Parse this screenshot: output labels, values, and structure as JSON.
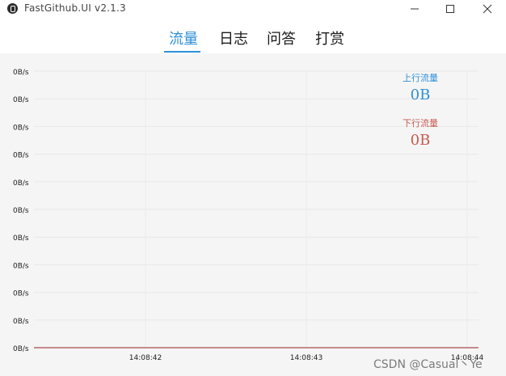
{
  "window": {
    "title": "FastGithub.UI v2.1.3"
  },
  "tabs": [
    {
      "label": "流量",
      "active": true
    },
    {
      "label": "日志",
      "active": false
    },
    {
      "label": "问答",
      "active": false
    },
    {
      "label": "打赏",
      "active": false
    }
  ],
  "legend": {
    "up_label": "上行流量",
    "up_value": "0B",
    "up_color": "#2f8fd8",
    "down_label": "下行流量",
    "down_value": "0B",
    "down_color": "#c85a50"
  },
  "watermark": "CSDN @Casual丶Ye",
  "chart_data": {
    "type": "line",
    "x": [
      "14:08:42",
      "14:08:43",
      "14:08:44"
    ],
    "y_tick_labels": [
      "0B/s",
      "0B/s",
      "0B/s",
      "0B/s",
      "0B/s",
      "0B/s",
      "0B/s",
      "0B/s",
      "0B/s",
      "0B/s",
      "0B/s"
    ],
    "series": [
      {
        "name": "上行流量",
        "values": [
          0,
          0,
          0
        ],
        "color": "#2f8fd8"
      },
      {
        "name": "下行流量",
        "values": [
          0,
          0,
          0
        ],
        "color": "#c85a50"
      }
    ],
    "ylim": [
      0,
      10
    ],
    "grid": true
  }
}
